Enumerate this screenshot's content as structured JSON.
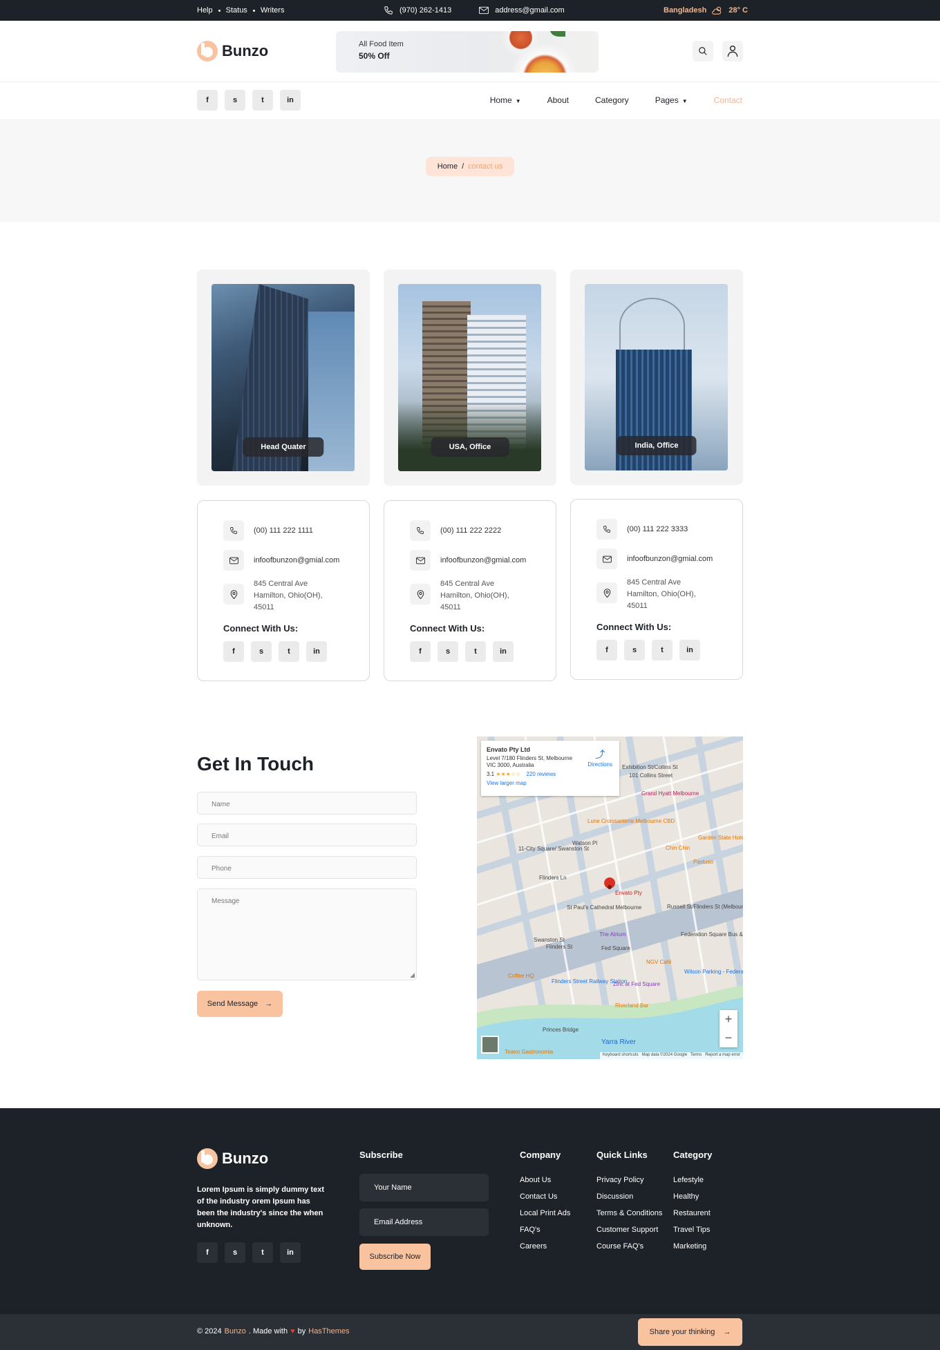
{
  "topbar": {
    "links": [
      "Help",
      "Status",
      "Writers"
    ],
    "phone": "(970) 262-1413",
    "email": "address@gmail.com",
    "country": "Bangladesh",
    "temperature": "28° C"
  },
  "header": {
    "logo_text": "Bunzo",
    "banner_line1": "All Food Item",
    "banner_line2": "50% Off",
    "social_icons": [
      "f",
      "s",
      "t",
      "in"
    ]
  },
  "nav": {
    "items": [
      "Home",
      "About",
      "Category",
      "Pages",
      "Contact"
    ],
    "active": "Contact"
  },
  "breadcrumb": {
    "home": "Home",
    "separator": "/",
    "current": "contact us"
  },
  "offices": [
    {
      "label": "Head Quater",
      "phone": "(00) 111 222 1111",
      "email": "infoofbunzon@gmial.com",
      "address": "845 Central Ave Hamilton, Ohio(OH), 45011"
    },
    {
      "label": "USA, Office",
      "phone": "(00) 111 222 2222",
      "email": "infoofbunzon@gmial.com",
      "address": "845 Central Ave Hamilton, Ohio(OH), 45011"
    },
    {
      "label": "India, Office",
      "phone": "(00) 111 222 3333",
      "email": "infoofbunzon@gmial.com",
      "address": "845 Central Ave Hamilton, Ohio(OH), 45011"
    }
  ],
  "connect_label": "Connect With Us:",
  "form": {
    "title": "Get In Touch",
    "name_placeholder": "Name",
    "email_placeholder": "Email",
    "phone_placeholder": "Phone",
    "message_placeholder": "Message",
    "send_label": "Send Message"
  },
  "map": {
    "place_name": "Envato Pty Ltd",
    "place_address": "Level 7/180 Flinders St, Melbourne VIC 3000, Australia",
    "rating": "3.1",
    "rating_stars": 3,
    "reviews": "220 reviews",
    "view_larger": "View larger map",
    "directions": "Directions",
    "pin_label": "Envato Pty",
    "labels": [
      "Exhibition St/Collins St",
      "101 Collins Street",
      "Grand Hyatt Melbourne",
      "Lune Croissanterie Melbourne CBD",
      "Chin Chin",
      "Pastuso",
      "11-City Square/ Swanston St",
      "St Paul's Cathedral Melbourne",
      "Russell St/Flinders St (Melbourne City)",
      "The Atrium",
      "Federation Square Bus & Coach Pickup",
      "Fed Square",
      "NGV Café",
      "Coffee HQ",
      "Flinders Street Railway Station",
      "Zinc at Fed Square",
      "Wilson Parking - Federation Square",
      "Riverland Bar",
      "Princes Bridge",
      "Yarra River",
      "Teatro Gastronomia",
      "Flinders Ln",
      "Flinders St",
      "Swanston St",
      "Watson Pl",
      "Garden State Hotel"
    ],
    "attribution": "Keyboard shortcuts   Map data ©2024 Google   Terms   Report a map error"
  },
  "footer": {
    "logo_text": "Bunzo",
    "about": "Lorem Ipsum is simply dummy text of the industry orem Ipsum has been the industry's since the when unknown.",
    "subscribe_title": "Subscribe",
    "name_placeholder": "Your Name",
    "email_placeholder": "Email Address",
    "subscribe_button": "Subscribe Now",
    "company_title": "Company",
    "company_links": [
      "About Us",
      "Contact Us",
      "Local Print Ads",
      "FAQ's",
      "Careers"
    ],
    "quick_title": "Quick Links",
    "quick_links": [
      "Privacy Policy",
      "Discussion",
      "Terms & Conditions",
      "Customer Support",
      "Course FAQ's"
    ],
    "category_title": "Category",
    "category_links": [
      "Lefestyle",
      "Healthy",
      "Restaurent",
      "Travel Tips",
      "Marketing"
    ]
  },
  "copyright": {
    "prefix": "© 2024",
    "brand": "Bunzo",
    "middle": ". Made with",
    "by": "by",
    "author": "HasThemes",
    "share_label": "Share your thinking"
  },
  "colors": {
    "dark": "#1d2128",
    "accent": "#f9c3a0",
    "accent_text": "#f0a272",
    "light_bg": "#f7f7f8"
  }
}
